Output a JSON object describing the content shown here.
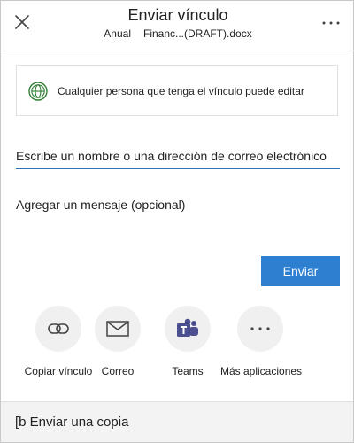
{
  "header": {
    "title": "Enviar vínculo",
    "subtitle_left": "Anual",
    "subtitle_file": "Financ...(DRAFT).docx"
  },
  "permission": {
    "text": "Cualquier persona que tenga el vínculo puede editar"
  },
  "form": {
    "recipient_placeholder": "Escribe un nombre o una dirección de correo electrónico",
    "recipient_value": "",
    "message_placeholder": "Agregar un mensaje (opcional)",
    "message_value": "",
    "send_label": "Enviar"
  },
  "apps": [
    {
      "label": "Copiar vínculo",
      "icon": "link-icon"
    },
    {
      "label": "Correo",
      "icon": "mail-icon"
    },
    {
      "label": "Teams",
      "icon": "teams-icon"
    },
    {
      "label": "Más aplicaciones",
      "icon": "more-horizontal-icon"
    }
  ],
  "footer": {
    "text": "[b Enviar una copia"
  },
  "colors": {
    "accent": "#2f7fd0",
    "input_underline": "#2a6fc0",
    "globe_green": "#2e7d32",
    "teams_purple": "#4b4e8f"
  }
}
